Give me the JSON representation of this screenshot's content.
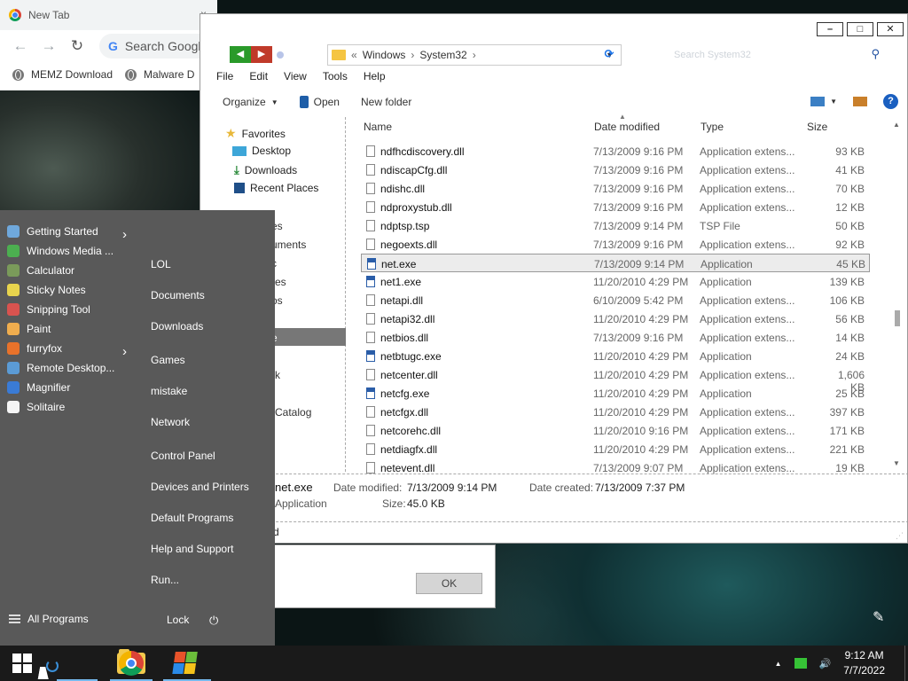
{
  "chrome": {
    "tab_title": "New Tab",
    "tab_close": "×",
    "search_placeholder": "Search Googl",
    "bookmarks": [
      "MEMZ Download",
      "Malware D"
    ]
  },
  "explorer": {
    "breadcrumb": [
      "Windows",
      "System32"
    ],
    "breadcrumb_prefix": "«",
    "search_placeholder": "Search System32",
    "menu": [
      "File",
      "Edit",
      "View",
      "Tools",
      "Help"
    ],
    "toolbar": {
      "organize": "Organize",
      "open": "Open",
      "new_folder": "New folder"
    },
    "nav": {
      "favorites": "Favorites",
      "desktop": "Desktop",
      "downloads": "Downloads",
      "recent": "Recent Places",
      "fragments": [
        "es",
        "uments",
        "c",
        "res",
        "os",
        "e",
        "rk",
        "Catalog"
      ]
    },
    "columns": {
      "name": "Name",
      "date": "Date modified",
      "type": "Type",
      "size": "Size"
    },
    "files": [
      {
        "name": "ndfhcdiscovery.dll",
        "date": "7/13/2009 9:16 PM",
        "type": "Application extens...",
        "size": "93 KB",
        "kind": "dll"
      },
      {
        "name": "ndiscapCfg.dll",
        "date": "7/13/2009 9:16 PM",
        "type": "Application extens...",
        "size": "41 KB",
        "kind": "dll"
      },
      {
        "name": "ndishc.dll",
        "date": "7/13/2009 9:16 PM",
        "type": "Application extens...",
        "size": "70 KB",
        "kind": "dll"
      },
      {
        "name": "ndproxystub.dll",
        "date": "7/13/2009 9:16 PM",
        "type": "Application extens...",
        "size": "12 KB",
        "kind": "dll"
      },
      {
        "name": "ndptsp.tsp",
        "date": "7/13/2009 9:14 PM",
        "type": "TSP File",
        "size": "50 KB",
        "kind": "file"
      },
      {
        "name": "negoexts.dll",
        "date": "7/13/2009 9:16 PM",
        "type": "Application extens...",
        "size": "92 KB",
        "kind": "dll"
      },
      {
        "name": "net.exe",
        "date": "7/13/2009 9:14 PM",
        "type": "Application",
        "size": "45 KB",
        "kind": "app",
        "selected": true
      },
      {
        "name": "net1.exe",
        "date": "11/20/2010 4:29 PM",
        "type": "Application",
        "size": "139 KB",
        "kind": "app"
      },
      {
        "name": "netapi.dll",
        "date": "6/10/2009 5:42 PM",
        "type": "Application extens...",
        "size": "106 KB",
        "kind": "dll"
      },
      {
        "name": "netapi32.dll",
        "date": "11/20/2010 4:29 PM",
        "type": "Application extens...",
        "size": "56 KB",
        "kind": "dll"
      },
      {
        "name": "netbios.dll",
        "date": "7/13/2009 9:16 PM",
        "type": "Application extens...",
        "size": "14 KB",
        "kind": "dll"
      },
      {
        "name": "netbtugc.exe",
        "date": "11/20/2010 4:29 PM",
        "type": "Application",
        "size": "24 KB",
        "kind": "app"
      },
      {
        "name": "netcenter.dll",
        "date": "11/20/2010 4:29 PM",
        "type": "Application extens...",
        "size": "1,606 KB",
        "kind": "dll"
      },
      {
        "name": "netcfg.exe",
        "date": "11/20/2010 4:29 PM",
        "type": "Application",
        "size": "25 KB",
        "kind": "app"
      },
      {
        "name": "netcfgx.dll",
        "date": "11/20/2010 4:29 PM",
        "type": "Application extens...",
        "size": "397 KB",
        "kind": "dll"
      },
      {
        "name": "netcorehc.dll",
        "date": "11/20/2010 9:16 PM",
        "type": "Application extens...",
        "size": "171 KB",
        "kind": "dll"
      },
      {
        "name": "netdiagfx.dll",
        "date": "11/20/2010 4:29 PM",
        "type": "Application extens...",
        "size": "221 KB",
        "kind": "dll"
      },
      {
        "name": "netevent.dll",
        "date": "7/13/2009 9:07 PM",
        "type": "Application extens...",
        "size": "19 KB",
        "kind": "dll"
      }
    ],
    "details": {
      "name": "net.exe",
      "type": "Application",
      "date_modified_label": "Date modified:",
      "date_modified": "7/13/2009 9:14 PM",
      "date_created_label": "Date created:",
      "date_created": "7/13/2009 7:37 PM",
      "size_label": "Size:",
      "size": "45.0 KB"
    },
    "status_fragment": "d"
  },
  "dialog": {
    "ok": "OK"
  },
  "start_menu": {
    "programs": [
      {
        "label": "Getting Started",
        "icon": "getting-started-icon",
        "arrow": true,
        "color": "#6fa8dc"
      },
      {
        "label": "Windows Media ...",
        "icon": "media-player-icon",
        "arrow": false,
        "color": "#4caf50"
      },
      {
        "label": "Calculator",
        "icon": "calculator-icon",
        "arrow": false,
        "color": "#7a9a5a"
      },
      {
        "label": "Sticky Notes",
        "icon": "sticky-notes-icon",
        "arrow": false,
        "color": "#e8d44d"
      },
      {
        "label": "Snipping Tool",
        "icon": "snipping-tool-icon",
        "arrow": false,
        "color": "#d9534f"
      },
      {
        "label": "Paint",
        "icon": "paint-icon",
        "arrow": false,
        "color": "#f0ad4e"
      },
      {
        "label": "furryfox",
        "icon": "furryfox-icon",
        "arrow": true,
        "color": "#e8722a"
      },
      {
        "label": "Remote Desktop...",
        "icon": "remote-desktop-icon",
        "arrow": false,
        "color": "#5b9bd5"
      },
      {
        "label": "Magnifier",
        "icon": "magnifier-icon",
        "arrow": false,
        "color": "#3a7bd5"
      },
      {
        "label": "Solitaire",
        "icon": "solitaire-icon",
        "arrow": false,
        "color": "#f5f5f5"
      }
    ],
    "places": [
      "LOL",
      "Documents",
      "Downloads",
      "Games",
      "mistake",
      "Network",
      "Control Panel",
      "Devices and Printers",
      "Default Programs",
      "Help and Support",
      "Run..."
    ],
    "all_programs": "All Programs",
    "lock": "Lock",
    "power": "⏻"
  },
  "taskbar": {
    "time": "9:12 AM",
    "date": "7/7/2022",
    "tray_up": "▲",
    "volume": "🔊"
  },
  "colors": {
    "start_menu_bg": "#595959",
    "taskbar_bg": "#1a1a1a",
    "selection": "#ececec"
  }
}
